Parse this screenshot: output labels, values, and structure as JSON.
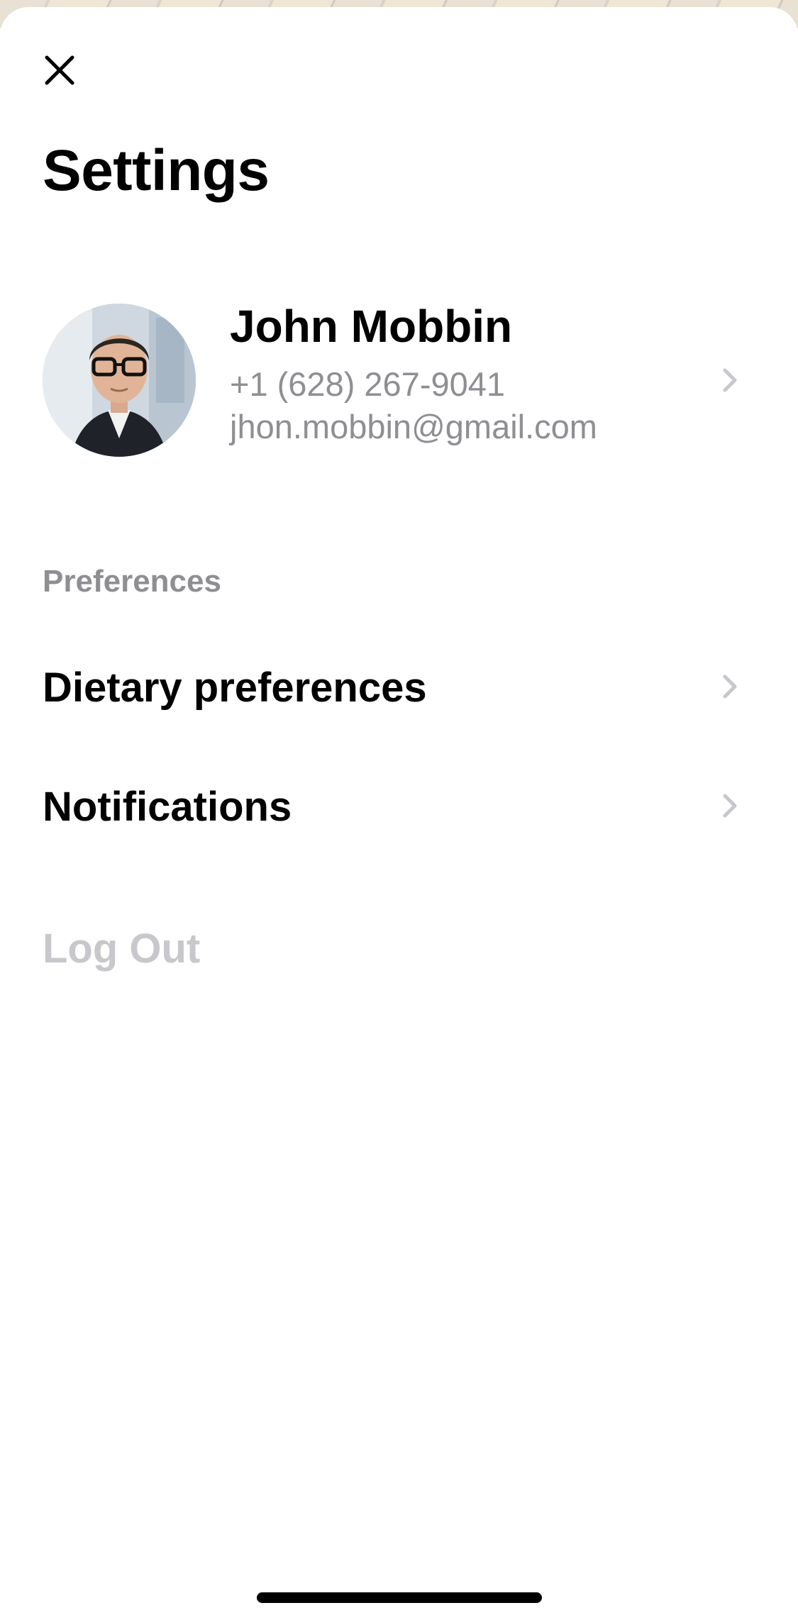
{
  "header": {
    "close_icon": "close-icon",
    "title": "Settings"
  },
  "profile": {
    "name": "John Mobbin",
    "phone": "+1 (628) 267-9041",
    "email": "jhon.mobbin@gmail.com",
    "avatar_icon": "avatar",
    "chevron_icon": "chevron-right-icon"
  },
  "preferences": {
    "section_title": "Preferences",
    "items": [
      {
        "label": "Dietary preferences",
        "icon": "chevron-right-icon"
      },
      {
        "label": "Notifications",
        "icon": "chevron-right-icon"
      }
    ]
  },
  "logout": {
    "label": "Log Out"
  },
  "colors": {
    "primary_text": "#000000",
    "secondary_text": "#8e8e93",
    "disabled_text": "#c7c7cc",
    "chevron": "#c7c7cc",
    "background": "#ffffff"
  }
}
